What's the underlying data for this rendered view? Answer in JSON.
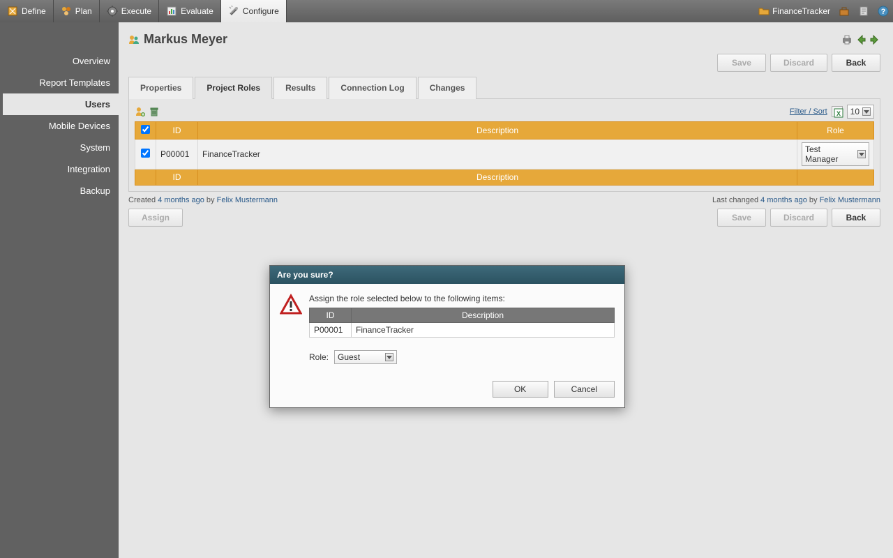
{
  "topnav": {
    "items": [
      {
        "label": "Define"
      },
      {
        "label": "Plan"
      },
      {
        "label": "Execute"
      },
      {
        "label": "Evaluate"
      },
      {
        "label": "Configure",
        "active": true
      }
    ],
    "project": "FinanceTracker"
  },
  "sidebar": {
    "items": [
      {
        "label": "Overview"
      },
      {
        "label": "Report Templates"
      },
      {
        "label": "Users",
        "active": true
      },
      {
        "label": "Mobile Devices"
      },
      {
        "label": "System"
      },
      {
        "label": "Integration"
      },
      {
        "label": "Backup"
      }
    ]
  },
  "page": {
    "title": "Markus Meyer",
    "buttons": {
      "save": "Save",
      "discard": "Discard",
      "back": "Back",
      "assign": "Assign"
    }
  },
  "tabs": [
    {
      "label": "Properties"
    },
    {
      "label": "Project Roles",
      "active": true
    },
    {
      "label": "Results"
    },
    {
      "label": "Connection Log"
    },
    {
      "label": "Changes"
    }
  ],
  "table": {
    "filter_label": "Filter / Sort",
    "page_size": "10",
    "columns": {
      "id": "ID",
      "description": "Description",
      "role": "Role"
    },
    "rows": [
      {
        "checked": true,
        "id": "P00001",
        "description": "FinanceTracker",
        "role": "Test Manager"
      }
    ]
  },
  "meta": {
    "created_label": "Created",
    "created_time": "4 months ago",
    "created_by_label": "by",
    "created_by": "Felix Mustermann",
    "changed_label": "Last changed",
    "changed_time": "4 months ago",
    "changed_by_label": "by",
    "changed_by": "Felix Mustermann"
  },
  "dialog": {
    "title": "Are you sure?",
    "message": "Assign the role selected below to the following items:",
    "columns": {
      "id": "ID",
      "description": "Description"
    },
    "items": [
      {
        "id": "P00001",
        "description": "FinanceTracker"
      }
    ],
    "role_label": "Role:",
    "role_value": "Guest",
    "ok": "OK",
    "cancel": "Cancel"
  }
}
